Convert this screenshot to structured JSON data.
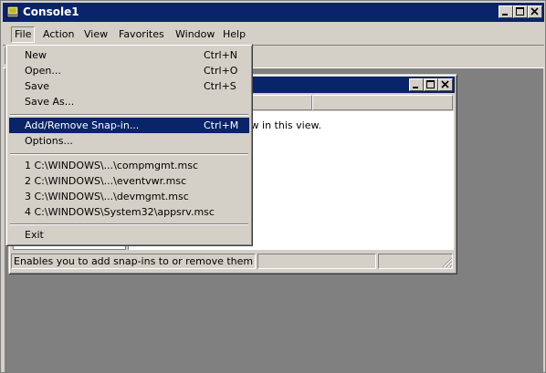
{
  "window": {
    "title": "Console1",
    "icon": "mmc-console-icon",
    "controls": [
      "minimize-icon",
      "maximize-icon",
      "close-icon"
    ]
  },
  "menubar": {
    "items": [
      "File",
      "Action",
      "View",
      "Favorites",
      "Window",
      "Help"
    ],
    "active": "File"
  },
  "file_menu": {
    "items": [
      {
        "label": "New",
        "shortcut": "Ctrl+N"
      },
      {
        "label": "Open...",
        "shortcut": "Ctrl+O"
      },
      {
        "label": "Save",
        "shortcut": "Ctrl+S"
      },
      {
        "label": "Save As...",
        "shortcut": ""
      },
      {
        "label": "Add/Remove Snap-in...",
        "shortcut": "Ctrl+M",
        "highlighted": true
      },
      {
        "label": "Options...",
        "shortcut": ""
      },
      {
        "label": "1 C:\\WINDOWS\\...\\compmgmt.msc",
        "shortcut": ""
      },
      {
        "label": "2 C:\\WINDOWS\\...\\eventvwr.msc",
        "shortcut": ""
      },
      {
        "label": "3 C:\\WINDOWS\\...\\devmgmt.msc",
        "shortcut": ""
      },
      {
        "label": "4 C:\\WINDOWS\\System32\\appsrv.msc",
        "shortcut": ""
      },
      {
        "label": "Exit",
        "shortcut": ""
      }
    ]
  },
  "child_window": {
    "list_empty_message": "There are no items to show in this view.",
    "status_text": "Enables you to add snap-ins to or remove them from th"
  },
  "colors": {
    "titlebar": "#0a246a",
    "face": "#d4d0c8",
    "workspace": "#808080",
    "highlight": "#0a246a"
  }
}
